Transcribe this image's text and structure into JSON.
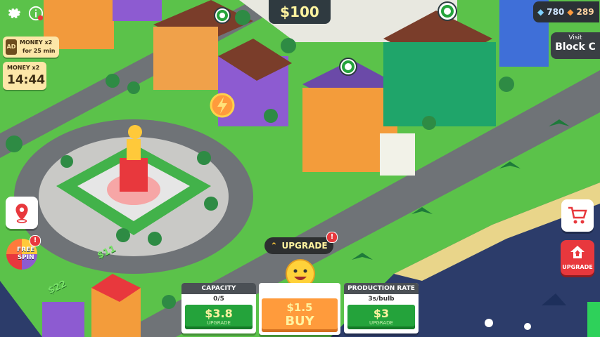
{
  "hud": {
    "balance": "$100",
    "gems": "780",
    "gold": "289",
    "visit_label": "Visit",
    "visit_target": "Block C"
  },
  "boosts": {
    "ad_badge": "AD",
    "ad_title": "MONEY x2",
    "ad_duration": "for 25 min",
    "timer_title": "MONEY x2",
    "timer_value": "14:44"
  },
  "side": {
    "free_spin_line1": "FREE",
    "free_spin_line2": "SPIN",
    "upgrade_label": "UPGRADE",
    "alert": "!"
  },
  "panel": {
    "upgrade_banner": "UPGRADE",
    "capacity_title": "CAPACITY",
    "capacity_value": "0/5",
    "capacity_price": "$3.8",
    "capacity_btn": "UPGRADE",
    "buy_price": "$1.5",
    "buy_label": "BUY",
    "production_title": "PRODUCTION RATE",
    "production_value": "3s/bulb",
    "production_price": "$3",
    "production_btn": "UPGRADE"
  },
  "world_labels": {
    "cash_stack_1": "$11",
    "cash_stack_2": "$22"
  },
  "colors": {
    "grass": "#5bc24a",
    "road": "#6f7377",
    "water": "#2c3c6a",
    "accent_green": "#24a33b",
    "accent_orange": "#ff9b3c",
    "accent_red": "#e8383d"
  }
}
